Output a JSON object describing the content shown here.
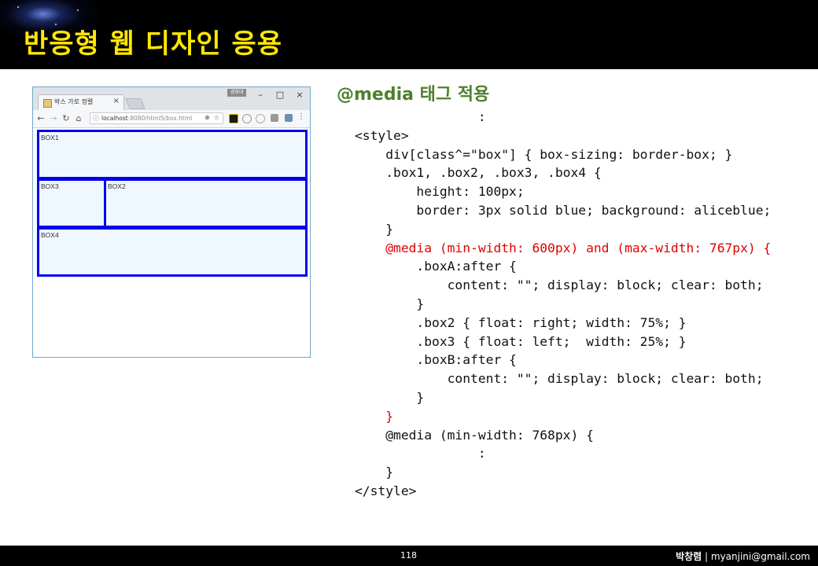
{
  "slide": {
    "title": "반응형 웹 디자인 응용",
    "heading": "@media 태그 적용",
    "page_number": "118",
    "author_name": "박창렴",
    "author_sep": " | ",
    "author_email": "myanjini@gmail.com"
  },
  "browser": {
    "tab_title": "박스 가로 정렬",
    "url_host": "localhost",
    "url_rest": ":8080/html5/box.html",
    "window_badge": "경희대",
    "boxes": [
      "BOX1",
      "BOX3",
      "BOX2",
      "BOX4"
    ]
  },
  "code": {
    "lines": [
      {
        "text": "                :",
        "highlight": false
      },
      {
        "text": "<style>",
        "highlight": false
      },
      {
        "text": "    div[class^=\"box\"] { box-sizing: border-box; }",
        "highlight": false
      },
      {
        "text": "    .box1, .box2, .box3, .box4 {",
        "highlight": false
      },
      {
        "text": "        height: 100px;",
        "highlight": false
      },
      {
        "text": "        border: 3px solid blue; background: aliceblue;",
        "highlight": false
      },
      {
        "text": "    }",
        "highlight": false
      },
      {
        "text": "    @media (min-width: 600px) and (max-width: 767px) {",
        "highlight": true
      },
      {
        "text": "        .boxA:after {",
        "highlight": false
      },
      {
        "text": "            content: \"\"; display: block; clear: both;",
        "highlight": false
      },
      {
        "text": "        }",
        "highlight": false
      },
      {
        "text": "        .box2 { float: right; width: 75%; }",
        "highlight": false
      },
      {
        "text": "        .box3 { float: left;  width: 25%; }",
        "highlight": false
      },
      {
        "text": "        .boxB:after {",
        "highlight": false
      },
      {
        "text": "            content: \"\"; display: block; clear: both;",
        "highlight": false
      },
      {
        "text": "        }",
        "highlight": false
      },
      {
        "text": "    }",
        "highlight": true
      },
      {
        "text": "    @media (min-width: 768px) {",
        "highlight": false
      },
      {
        "text": "                :",
        "highlight": false
      },
      {
        "text": "    }",
        "highlight": false
      },
      {
        "text": "</style>",
        "highlight": false
      }
    ]
  }
}
